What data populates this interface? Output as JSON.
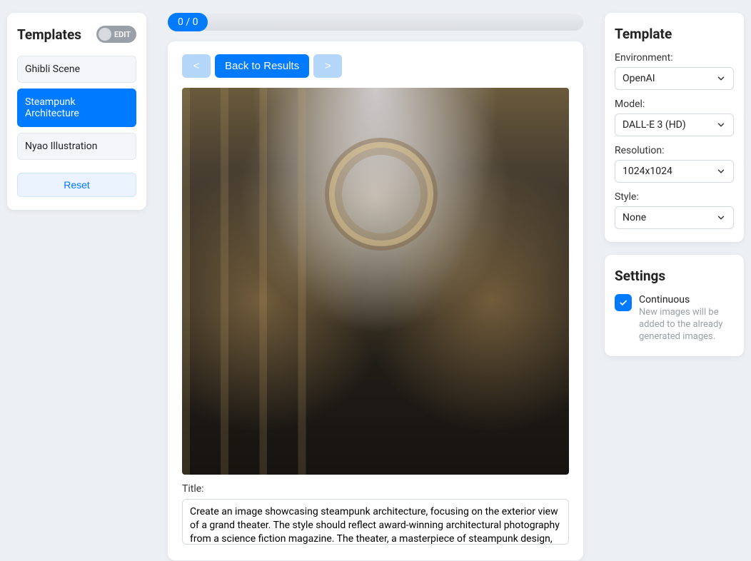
{
  "left": {
    "title": "Templates",
    "edit_label": "EDIT",
    "items": [
      {
        "label": "Ghibli Scene",
        "active": false
      },
      {
        "label": "Steampunk Architecture",
        "active": true
      },
      {
        "label": "Nyao Illustration",
        "active": false
      }
    ],
    "reset_label": "Reset"
  },
  "mid": {
    "progress": "0 / 0",
    "prev_label": "<",
    "back_label": "Back to Results",
    "next_label": ">",
    "title_label": "Title:",
    "prompt_value": "Create an image showcasing steampunk architecture, focusing on the exterior view of a grand theater. The style should reflect award-winning architectural photography from a science fiction magazine. The theater, a masterpiece of steampunk design,"
  },
  "right": {
    "template_title": "Template",
    "env_label": "Environment:",
    "env_value": "OpenAI",
    "model_label": "Model:",
    "model_value": "DALL-E 3 (HD)",
    "res_label": "Resolution:",
    "res_value": "1024x1024",
    "style_label": "Style:",
    "style_value": "None",
    "settings_title": "Settings",
    "continuous_label": "Continuous",
    "continuous_desc": "New images will be added to the already generated images."
  }
}
